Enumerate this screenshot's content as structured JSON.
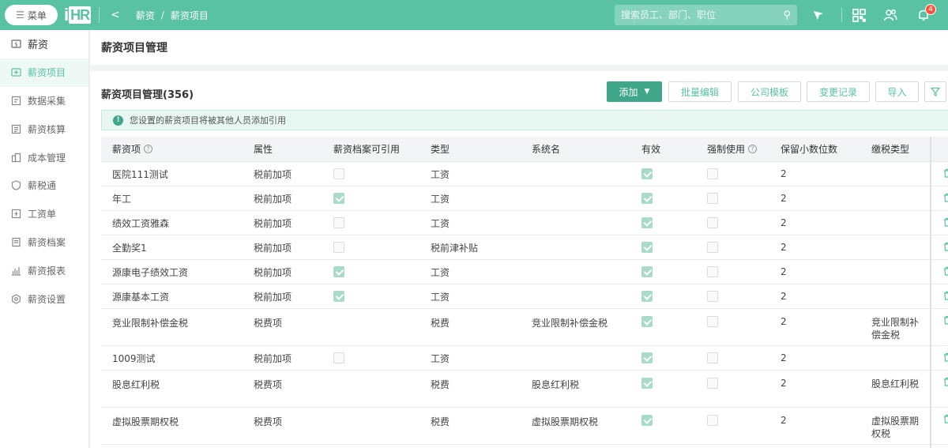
{
  "topbar": {
    "menu_label": "菜单",
    "logo_text": "iHR",
    "back_glyph": "<",
    "breadcrumb": [
      "薪资",
      "薪资项目"
    ],
    "search_placeholder": "搜索员工、部门、职位",
    "notification_count": "4",
    "icons": [
      "search-icon",
      "flag-icon",
      "qrcode-icon",
      "users-icon",
      "bell-icon"
    ]
  },
  "sidebar": {
    "items": [
      {
        "label": "薪资",
        "icon": "salary-icon",
        "active": false
      },
      {
        "label": "薪资项目",
        "icon": "salary-item-icon",
        "active": true
      },
      {
        "label": "数据采集",
        "icon": "data-collect-icon",
        "active": false
      },
      {
        "label": "薪资核算",
        "icon": "calc-icon",
        "active": false
      },
      {
        "label": "成本管理",
        "icon": "cost-icon",
        "active": false
      },
      {
        "label": "薪税通",
        "icon": "shield-icon",
        "active": false
      },
      {
        "label": "工资单",
        "icon": "payslip-icon",
        "active": false
      },
      {
        "label": "薪资档案",
        "icon": "archive-icon",
        "active": false
      },
      {
        "label": "薪资报表",
        "icon": "report-icon",
        "active": false
      },
      {
        "label": "薪资设置",
        "icon": "gear-icon",
        "active": false
      }
    ]
  },
  "page": {
    "title": "薪资项目管理",
    "section_title": "薪资项目管理(356)",
    "buttons": {
      "add": "添加",
      "batch_edit": "批量编辑",
      "company_template": "公司模板",
      "change_log": "变更记录",
      "import": "导入"
    },
    "notice": "您设置的薪资项目将被其他人员添加引用"
  },
  "table": {
    "headers": [
      "薪资项",
      "属性",
      "薪资档案可引用",
      "类型",
      "系统名",
      "有效",
      "强制使用",
      "保留小数位数",
      "缴税类型"
    ],
    "rows": [
      {
        "name": "医院111测试",
        "attr": "税前加项",
        "ref": false,
        "type": "工资",
        "sysname": "",
        "valid": true,
        "force": false,
        "decimals": "2",
        "tax": ""
      },
      {
        "name": "年工",
        "attr": "税前加项",
        "ref": true,
        "type": "工资",
        "sysname": "",
        "valid": true,
        "force": false,
        "decimals": "2",
        "tax": ""
      },
      {
        "name": "绩效工资雅森",
        "attr": "税前加项",
        "ref": false,
        "type": "工资",
        "sysname": "",
        "valid": true,
        "force": false,
        "decimals": "2",
        "tax": ""
      },
      {
        "name": "全勤奖1",
        "attr": "税前加项",
        "ref": false,
        "type": "税前津补贴",
        "sysname": "",
        "valid": true,
        "force": false,
        "decimals": "2",
        "tax": ""
      },
      {
        "name": "源康电子绩效工资",
        "attr": "税前加项",
        "ref": true,
        "type": "工资",
        "sysname": "",
        "valid": true,
        "force": false,
        "decimals": "2",
        "tax": ""
      },
      {
        "name": "源康基本工资",
        "attr": "税前加项",
        "ref": true,
        "type": "工资",
        "sysname": "",
        "valid": true,
        "force": false,
        "decimals": "2",
        "tax": ""
      },
      {
        "name": "竞业限制补偿金税",
        "attr": "税费项",
        "ref": null,
        "type": "税费",
        "sysname": "竞业限制补偿金税",
        "valid": true,
        "force": false,
        "decimals": "2",
        "tax": "竞业限制补偿金税"
      },
      {
        "name": "1009测试",
        "attr": "税前加项",
        "ref": false,
        "type": "工资",
        "sysname": "",
        "valid": true,
        "force": false,
        "decimals": "2",
        "tax": ""
      },
      {
        "name": "股息红利税",
        "attr": "税费项",
        "ref": null,
        "type": "税费",
        "sysname": "股息红利税",
        "valid": true,
        "force": false,
        "decimals": "2",
        "tax": "股息红利税"
      },
      {
        "name": "虚拟股票期权税",
        "attr": "税费项",
        "ref": null,
        "type": "税费",
        "sysname": "虚拟股票期权税",
        "valid": true,
        "force": false,
        "decimals": "2",
        "tax": "虚拟股票期权税"
      }
    ]
  },
  "colors": {
    "brand": "#58c2a2",
    "primary_button": "#3fa68a",
    "checkbox_on": "#a8dcc9"
  }
}
